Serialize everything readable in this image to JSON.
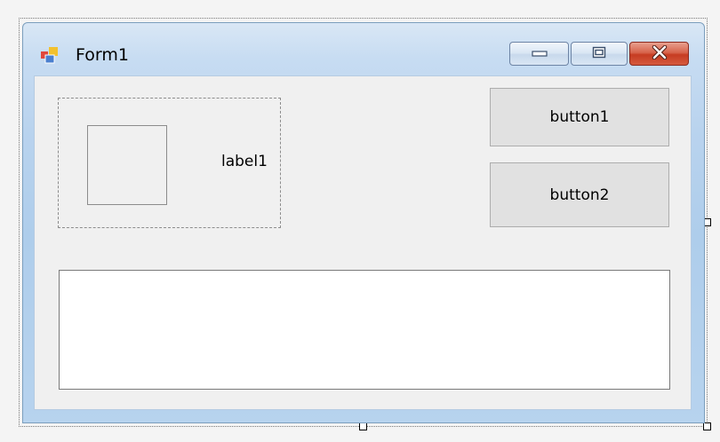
{
  "window": {
    "title": "Form1",
    "icon": "form-icon",
    "caption_buttons": [
      "minimize-icon",
      "maximize-icon",
      "close-icon"
    ]
  },
  "controls": {
    "label1": "label1",
    "button1": "button1",
    "button2": "button2",
    "textbox_value": ""
  },
  "colors": {
    "close_button": "#c63c22",
    "client_background": "#f0f0f0",
    "frame_border": "#7b9ebd"
  }
}
